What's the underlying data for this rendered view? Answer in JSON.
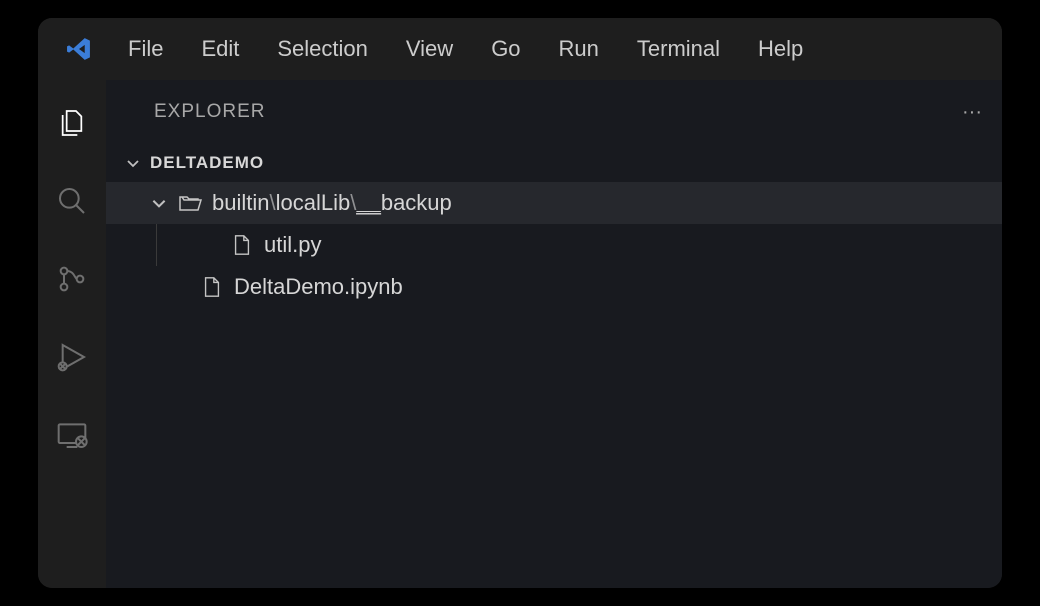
{
  "menu": {
    "file": "File",
    "edit": "Edit",
    "selection": "Selection",
    "view": "View",
    "go": "Go",
    "run": "Run",
    "terminal": "Terminal",
    "help": "Help"
  },
  "sidebar": {
    "title": "EXPLORER",
    "ellipsis": "···"
  },
  "workspace": {
    "name": "DELTADEMO"
  },
  "tree": {
    "folder": {
      "prefix": "builtin",
      "sep1": "\\",
      "mid": "localLib",
      "sep2": "\\",
      "last_underscore": "__",
      "last": "backup"
    },
    "file1": "util.py",
    "file2": "DeltaDemo.ipynb"
  }
}
